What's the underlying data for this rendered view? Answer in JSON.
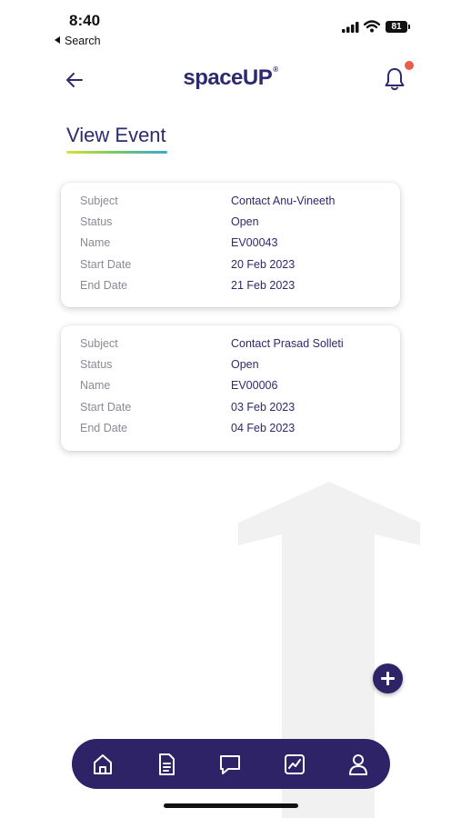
{
  "status_bar": {
    "time": "8:40",
    "back_label": "Search",
    "battery": "81"
  },
  "header": {
    "logo_text": "spaceUP",
    "logo_mark": "®"
  },
  "page": {
    "title": "View Event"
  },
  "events": [
    {
      "rows": [
        {
          "label": "Subject",
          "value": "Contact Anu-Vineeth"
        },
        {
          "label": "Status",
          "value": "Open"
        },
        {
          "label": "Name",
          "value": "EV00043"
        },
        {
          "label": "Start Date",
          "value": "20 Feb 2023"
        },
        {
          "label": "End Date",
          "value": "21 Feb 2023"
        }
      ]
    },
    {
      "rows": [
        {
          "label": "Subject",
          "value": "Contact Prasad Solleti"
        },
        {
          "label": "Status",
          "value": "Open"
        },
        {
          "label": "Name",
          "value": "EV00006"
        },
        {
          "label": "Start Date",
          "value": "03 Feb 2023"
        },
        {
          "label": "End Date",
          "value": "04 Feb 2023"
        }
      ]
    }
  ],
  "icons": {
    "back": "arrow-left-icon",
    "bell": "bell-icon",
    "fab": "plus-icon",
    "nav": [
      "home-icon",
      "document-icon",
      "chat-icon",
      "chart-icon",
      "user-icon"
    ]
  },
  "colors": {
    "primary": "#2d2366",
    "text": "#2d2a6e",
    "label": "#8a8a95",
    "notification": "#e85b4d"
  }
}
